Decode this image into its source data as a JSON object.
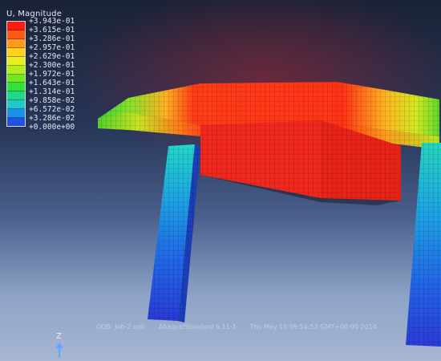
{
  "legend": {
    "title": "U, Magnitude",
    "values": [
      "+3.943e-01",
      "+3.615e-01",
      "+3.286e-01",
      "+2.957e-01",
      "+2.629e-01",
      "+2.300e-01",
      "+1.972e-01",
      "+1.643e-01",
      "+1.314e-01",
      "+9.858e-02",
      "+6.572e-02",
      "+3.286e-02",
      "+0.000e+00"
    ],
    "colors": [
      "#ff1a10",
      "#ff5a14",
      "#ff9a18",
      "#ffd21e",
      "#e6f01e",
      "#b2ee1e",
      "#6fe81e",
      "#2fe23c",
      "#1fd88c",
      "#1ec8cc",
      "#1e8fe8",
      "#2050e8"
    ]
  },
  "footer": {
    "odb": "ODB: Job-2.odb",
    "solver": "Abaqus/Standard 6.11-1",
    "timestamp": "Thu May 15 09:54:52 GMT+00:00 2014"
  },
  "triad": {
    "axis_label": "Z"
  }
}
